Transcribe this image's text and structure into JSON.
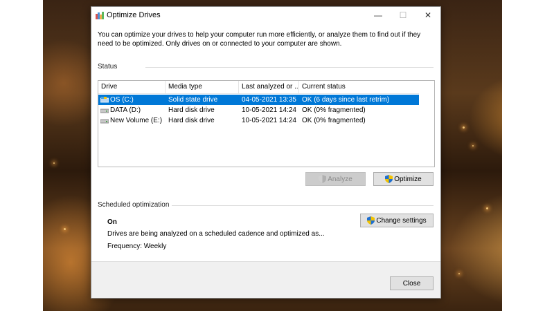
{
  "window": {
    "title": "Optimize Drives",
    "caption": {
      "minimize": "—",
      "maximize": "☐",
      "close": "✕"
    }
  },
  "intro_text": "You can optimize your drives to help your computer run more efficiently, or analyze them to find out if they need to be optimized. Only drives on or connected to your computer are shown.",
  "status": {
    "label": "Status",
    "columns": [
      "Drive",
      "Media type",
      "Last analyzed or ...",
      "Current status"
    ],
    "rows": [
      {
        "drive": "OS (C:)",
        "media_type": "Solid state drive",
        "last_analyzed": "04-05-2021 13:35",
        "current_status": "OK (6 days since last retrim)",
        "selected": true
      },
      {
        "drive": "DATA (D:)",
        "media_type": "Hard disk drive",
        "last_analyzed": "10-05-2021 14:24",
        "current_status": "OK (0% fragmented)",
        "selected": false
      },
      {
        "drive": "New Volume (E:)",
        "media_type": "Hard disk drive",
        "last_analyzed": "10-05-2021 14:24",
        "current_status": "OK (0% fragmented)",
        "selected": false
      }
    ],
    "analyze_label": "Analyze",
    "optimize_label": "Optimize"
  },
  "scheduled": {
    "label": "Scheduled optimization",
    "state": "On",
    "description": "Drives are being analyzed on a scheduled cadence and optimized as...",
    "frequency": "Frequency: Weekly",
    "change_settings_label": "Change settings"
  },
  "close_label": "Close",
  "icons": {
    "app": "optimize-drives-app-icon",
    "ssd": "ssd-drive-icon",
    "hdd": "hard-disk-drive-icon",
    "shield": "uac-shield-icon"
  },
  "colors": {
    "selection": "#0078d7",
    "window_bg": "#f0f0f0",
    "button_bg": "#e1e1e1"
  }
}
